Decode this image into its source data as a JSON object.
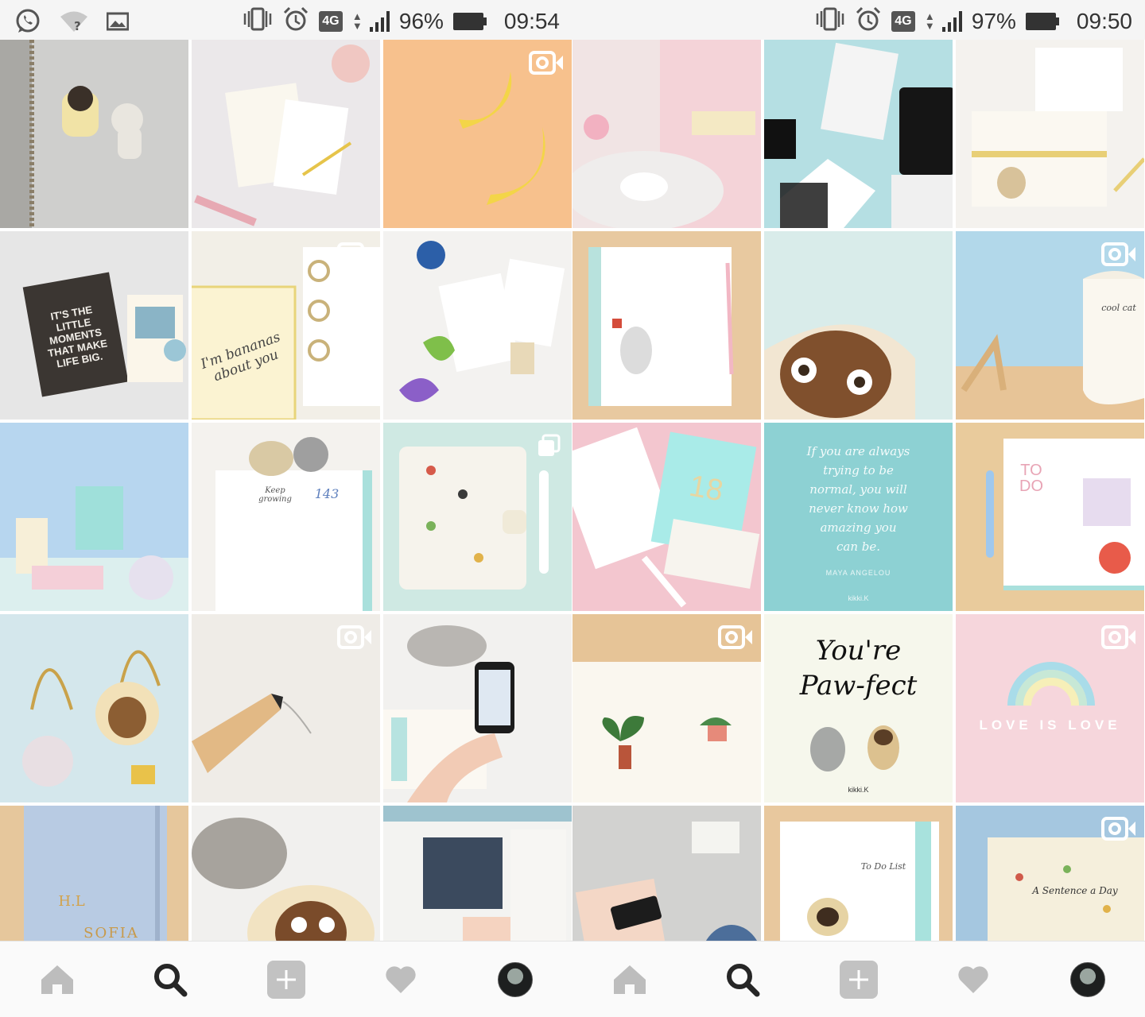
{
  "left_screen": {
    "status": {
      "lte": "4G",
      "battery": "96%",
      "time": "09:54"
    }
  },
  "right_screen": {
    "status": {
      "lte": "4G",
      "battery": "97%",
      "time": "09:50"
    }
  },
  "tile_text": {
    "bananas_line1": "I'm bananas",
    "bananas_line2": "about you",
    "quote_lines": [
      "If you are always",
      "trying to be",
      "normal, you will",
      "never know how",
      "amazing you",
      "can be."
    ],
    "quote_author": "MAYA ANGELOU",
    "quote_brand": "kikki.K",
    "pawfect_line1": "You're",
    "pawfect_line2": "Paw-fect",
    "pawfect_brand": "kikki.K",
    "love": "LOVE IS LOVE",
    "todo": "TO DO",
    "little_moments": "IT'S THE LITTLE MOMENTS THAT MAKE LIFE BIG.",
    "notebook_initials": "H.L",
    "notebook_name": "SOFIA",
    "diary_number": "18",
    "page_number": "143",
    "sentence": "A Sentence a Day",
    "todo_list": "To Do List",
    "cool_cat": "cool cat",
    "keep_growing": "Keep growing"
  },
  "icons": {
    "video": "video-camera-icon",
    "multi": "multiple-posts-icon",
    "home": "home-icon",
    "search": "search-icon",
    "add": "add-post-icon",
    "activity": "heart-icon",
    "profile": "profile-avatar"
  },
  "colors": {
    "status_bg": "#f5f5f5",
    "nav_bg": "#fafafa",
    "icon_inactive": "#bdbdbd",
    "icon_active": "#262626"
  }
}
